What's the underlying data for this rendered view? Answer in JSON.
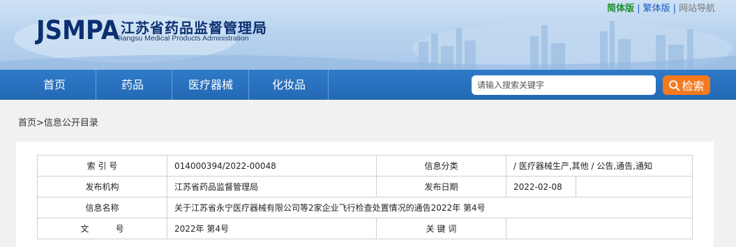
{
  "header": {
    "logo_abbr": "JSMPA",
    "logo_cn": "江苏省药品监督管理局",
    "logo_en": "Jiangsu Medical Products Administration",
    "toplinks": {
      "simplified": "简体版",
      "separator": "|",
      "traditional": "繁体版",
      "site_nav": "网站导航"
    }
  },
  "nav": {
    "items": [
      "首页",
      "药品",
      "医疗器械",
      "化妆品"
    ]
  },
  "search": {
    "placeholder": "请输入搜索关键字",
    "button_label": "检索"
  },
  "breadcrumb": {
    "home": "首页",
    "separator": ">",
    "current": "信息公开目录"
  },
  "info_table": {
    "index_label": "索 引 号",
    "index_value": "014000394/2022-00048",
    "category_label": "信息分类",
    "category_value": "/  医疗器械生产,其他  /  公告,通告,通知",
    "publisher_label": "发布机构",
    "publisher_value": "江苏省药品监督管理局",
    "date_label": "发布日期",
    "date_value": "2022-02-08",
    "name_label": "信息名称",
    "name_value": "关于江苏省永宁医疗器械有限公司等2家企业飞行检查处置情况的通告2022年 第4号",
    "docno_label": "文          号",
    "docno_value": "2022年 第4号",
    "keywords_label": "关 键 词",
    "keywords_value": ""
  },
  "colors": {
    "nav_bg": "#2369b5",
    "search_button": "#f47a1f",
    "logo_text": "#0b2f70",
    "simplified_link": "#1f8f2f"
  }
}
